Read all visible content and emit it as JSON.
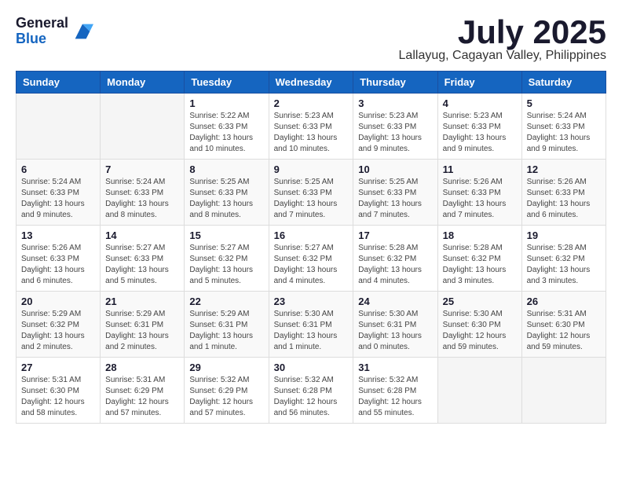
{
  "header": {
    "logo_general": "General",
    "logo_blue": "Blue",
    "month_title": "July 2025",
    "location": "Lallayug, Cagayan Valley, Philippines"
  },
  "weekdays": [
    "Sunday",
    "Monday",
    "Tuesday",
    "Wednesday",
    "Thursday",
    "Friday",
    "Saturday"
  ],
  "weeks": [
    [
      {
        "day": "",
        "sunrise": "",
        "sunset": "",
        "daylight": ""
      },
      {
        "day": "",
        "sunrise": "",
        "sunset": "",
        "daylight": ""
      },
      {
        "day": "1",
        "sunrise": "Sunrise: 5:22 AM",
        "sunset": "Sunset: 6:33 PM",
        "daylight": "Daylight: 13 hours and 10 minutes."
      },
      {
        "day": "2",
        "sunrise": "Sunrise: 5:23 AM",
        "sunset": "Sunset: 6:33 PM",
        "daylight": "Daylight: 13 hours and 10 minutes."
      },
      {
        "day": "3",
        "sunrise": "Sunrise: 5:23 AM",
        "sunset": "Sunset: 6:33 PM",
        "daylight": "Daylight: 13 hours and 9 minutes."
      },
      {
        "day": "4",
        "sunrise": "Sunrise: 5:23 AM",
        "sunset": "Sunset: 6:33 PM",
        "daylight": "Daylight: 13 hours and 9 minutes."
      },
      {
        "day": "5",
        "sunrise": "Sunrise: 5:24 AM",
        "sunset": "Sunset: 6:33 PM",
        "daylight": "Daylight: 13 hours and 9 minutes."
      }
    ],
    [
      {
        "day": "6",
        "sunrise": "Sunrise: 5:24 AM",
        "sunset": "Sunset: 6:33 PM",
        "daylight": "Daylight: 13 hours and 9 minutes."
      },
      {
        "day": "7",
        "sunrise": "Sunrise: 5:24 AM",
        "sunset": "Sunset: 6:33 PM",
        "daylight": "Daylight: 13 hours and 8 minutes."
      },
      {
        "day": "8",
        "sunrise": "Sunrise: 5:25 AM",
        "sunset": "Sunset: 6:33 PM",
        "daylight": "Daylight: 13 hours and 8 minutes."
      },
      {
        "day": "9",
        "sunrise": "Sunrise: 5:25 AM",
        "sunset": "Sunset: 6:33 PM",
        "daylight": "Daylight: 13 hours and 7 minutes."
      },
      {
        "day": "10",
        "sunrise": "Sunrise: 5:25 AM",
        "sunset": "Sunset: 6:33 PM",
        "daylight": "Daylight: 13 hours and 7 minutes."
      },
      {
        "day": "11",
        "sunrise": "Sunrise: 5:26 AM",
        "sunset": "Sunset: 6:33 PM",
        "daylight": "Daylight: 13 hours and 7 minutes."
      },
      {
        "day": "12",
        "sunrise": "Sunrise: 5:26 AM",
        "sunset": "Sunset: 6:33 PM",
        "daylight": "Daylight: 13 hours and 6 minutes."
      }
    ],
    [
      {
        "day": "13",
        "sunrise": "Sunrise: 5:26 AM",
        "sunset": "Sunset: 6:33 PM",
        "daylight": "Daylight: 13 hours and 6 minutes."
      },
      {
        "day": "14",
        "sunrise": "Sunrise: 5:27 AM",
        "sunset": "Sunset: 6:33 PM",
        "daylight": "Daylight: 13 hours and 5 minutes."
      },
      {
        "day": "15",
        "sunrise": "Sunrise: 5:27 AM",
        "sunset": "Sunset: 6:32 PM",
        "daylight": "Daylight: 13 hours and 5 minutes."
      },
      {
        "day": "16",
        "sunrise": "Sunrise: 5:27 AM",
        "sunset": "Sunset: 6:32 PM",
        "daylight": "Daylight: 13 hours and 4 minutes."
      },
      {
        "day": "17",
        "sunrise": "Sunrise: 5:28 AM",
        "sunset": "Sunset: 6:32 PM",
        "daylight": "Daylight: 13 hours and 4 minutes."
      },
      {
        "day": "18",
        "sunrise": "Sunrise: 5:28 AM",
        "sunset": "Sunset: 6:32 PM",
        "daylight": "Daylight: 13 hours and 3 minutes."
      },
      {
        "day": "19",
        "sunrise": "Sunrise: 5:28 AM",
        "sunset": "Sunset: 6:32 PM",
        "daylight": "Daylight: 13 hours and 3 minutes."
      }
    ],
    [
      {
        "day": "20",
        "sunrise": "Sunrise: 5:29 AM",
        "sunset": "Sunset: 6:32 PM",
        "daylight": "Daylight: 13 hours and 2 minutes."
      },
      {
        "day": "21",
        "sunrise": "Sunrise: 5:29 AM",
        "sunset": "Sunset: 6:31 PM",
        "daylight": "Daylight: 13 hours and 2 minutes."
      },
      {
        "day": "22",
        "sunrise": "Sunrise: 5:29 AM",
        "sunset": "Sunset: 6:31 PM",
        "daylight": "Daylight: 13 hours and 1 minute."
      },
      {
        "day": "23",
        "sunrise": "Sunrise: 5:30 AM",
        "sunset": "Sunset: 6:31 PM",
        "daylight": "Daylight: 13 hours and 1 minute."
      },
      {
        "day": "24",
        "sunrise": "Sunrise: 5:30 AM",
        "sunset": "Sunset: 6:31 PM",
        "daylight": "Daylight: 13 hours and 0 minutes."
      },
      {
        "day": "25",
        "sunrise": "Sunrise: 5:30 AM",
        "sunset": "Sunset: 6:30 PM",
        "daylight": "Daylight: 12 hours and 59 minutes."
      },
      {
        "day": "26",
        "sunrise": "Sunrise: 5:31 AM",
        "sunset": "Sunset: 6:30 PM",
        "daylight": "Daylight: 12 hours and 59 minutes."
      }
    ],
    [
      {
        "day": "27",
        "sunrise": "Sunrise: 5:31 AM",
        "sunset": "Sunset: 6:30 PM",
        "daylight": "Daylight: 12 hours and 58 minutes."
      },
      {
        "day": "28",
        "sunrise": "Sunrise: 5:31 AM",
        "sunset": "Sunset: 6:29 PM",
        "daylight": "Daylight: 12 hours and 57 minutes."
      },
      {
        "day": "29",
        "sunrise": "Sunrise: 5:32 AM",
        "sunset": "Sunset: 6:29 PM",
        "daylight": "Daylight: 12 hours and 57 minutes."
      },
      {
        "day": "30",
        "sunrise": "Sunrise: 5:32 AM",
        "sunset": "Sunset: 6:28 PM",
        "daylight": "Daylight: 12 hours and 56 minutes."
      },
      {
        "day": "31",
        "sunrise": "Sunrise: 5:32 AM",
        "sunset": "Sunset: 6:28 PM",
        "daylight": "Daylight: 12 hours and 55 minutes."
      },
      {
        "day": "",
        "sunrise": "",
        "sunset": "",
        "daylight": ""
      },
      {
        "day": "",
        "sunrise": "",
        "sunset": "",
        "daylight": ""
      }
    ]
  ]
}
